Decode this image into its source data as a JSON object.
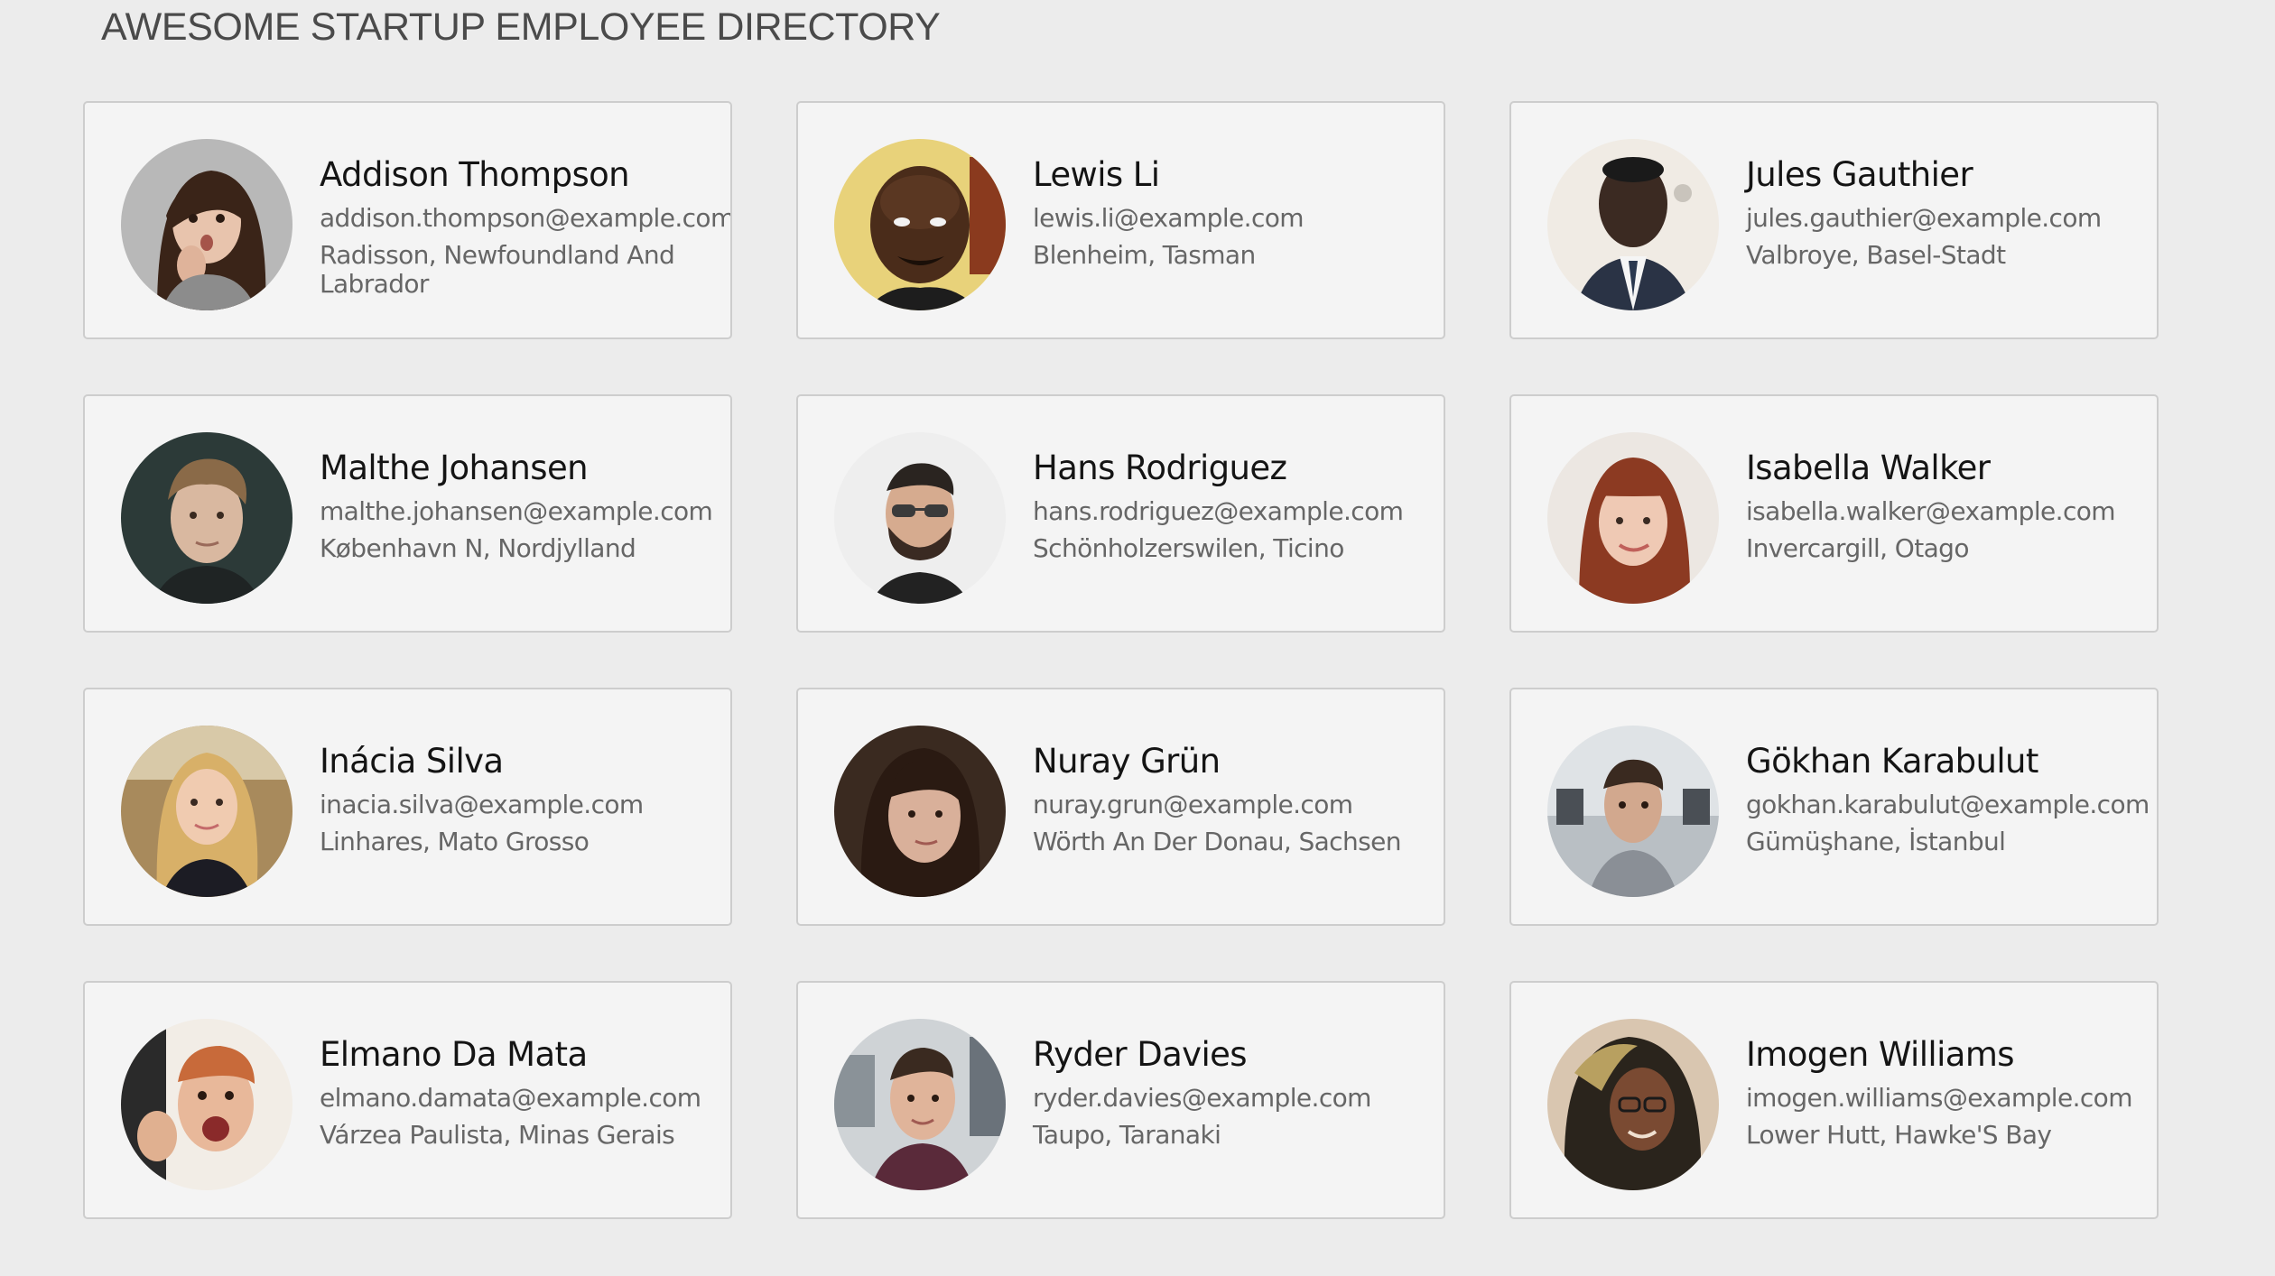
{
  "header": {
    "title": "AWESOME STARTUP EMPLOYEE DIRECTORY"
  },
  "employees": [
    {
      "name": "Addison Thompson",
      "email": "addison.thompson@example.com",
      "location": "Radisson, Newfoundland And Labrador",
      "avatar_icon": "female-avatar-photo"
    },
    {
      "name": "Lewis Li",
      "email": "lewis.li@example.com",
      "location": "Blenheim, Tasman",
      "avatar_icon": "male-avatar-photo"
    },
    {
      "name": "Jules Gauthier",
      "email": "jules.gauthier@example.com",
      "location": "Valbroye, Basel-Stadt",
      "avatar_icon": "male-avatar-photo"
    },
    {
      "name": "Malthe Johansen",
      "email": "malthe.johansen@example.com",
      "location": "København N, Nordjylland",
      "avatar_icon": "male-avatar-photo"
    },
    {
      "name": "Hans Rodriguez",
      "email": "hans.rodriguez@example.com",
      "location": "Schönholzerswilen, Ticino",
      "avatar_icon": "male-avatar-photo"
    },
    {
      "name": "Isabella Walker",
      "email": "isabella.walker@example.com",
      "location": "Invercargill, Otago",
      "avatar_icon": "female-avatar-photo"
    },
    {
      "name": "Inácia Silva",
      "email": "inacia.silva@example.com",
      "location": "Linhares, Mato Grosso",
      "avatar_icon": "female-avatar-photo"
    },
    {
      "name": "Nuray Grün",
      "email": "nuray.grun@example.com",
      "location": "Wörth An Der Donau, Sachsen",
      "avatar_icon": "female-avatar-photo"
    },
    {
      "name": "Gökhan Karabulut",
      "email": "gokhan.karabulut@example.com",
      "location": "Gümüşhane, İstanbul",
      "avatar_icon": "male-avatar-photo"
    },
    {
      "name": "Elmano Da Mata",
      "email": "elmano.damata@example.com",
      "location": "Várzea Paulista, Minas Gerais",
      "avatar_icon": "male-avatar-photo"
    },
    {
      "name": "Ryder Davies",
      "email": "ryder.davies@example.com",
      "location": "Taupo, Taranaki",
      "avatar_icon": "male-avatar-photo"
    },
    {
      "name": "Imogen Williams",
      "email": "imogen.williams@example.com",
      "location": "Lower Hutt, Hawke'S Bay",
      "avatar_icon": "female-avatar-photo"
    }
  ]
}
